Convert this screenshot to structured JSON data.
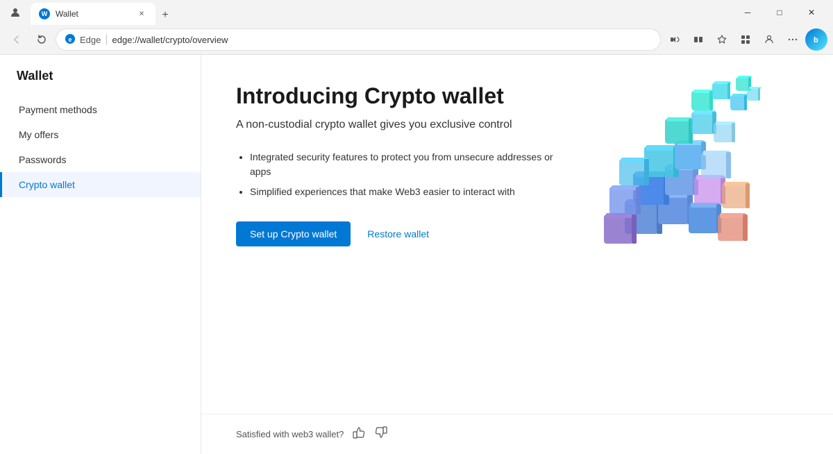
{
  "titlebar": {
    "tab_title": "Wallet",
    "tab_favicon_text": "W",
    "close_label": "✕",
    "minimize_label": "─",
    "maximize_label": "□",
    "new_tab_label": "+"
  },
  "addressbar": {
    "back_icon": "←",
    "refresh_icon": "↻",
    "edge_label": "Edge",
    "separator": "|",
    "url": "edge://wallet/crypto/overview",
    "bing_label": "b"
  },
  "sidebar": {
    "title": "Wallet",
    "nav_items": [
      {
        "label": "Payment methods",
        "active": false
      },
      {
        "label": "My offers",
        "active": false
      },
      {
        "label": "Passwords",
        "active": false
      },
      {
        "label": "Crypto wallet",
        "active": true
      }
    ]
  },
  "main": {
    "heading": "Introducing Crypto wallet",
    "subheading": "A non-custodial crypto wallet gives you exclusive control",
    "features": [
      "Integrated security features to protect you from unsecure addresses or apps",
      "Simplified experiences that make Web3 easier to interact with"
    ],
    "setup_button": "Set up Crypto wallet",
    "restore_link": "Restore wallet"
  },
  "footer": {
    "feedback_label": "Satisfied with web3 wallet?",
    "thumbs_up": "👍",
    "thumbs_down": "👎"
  }
}
